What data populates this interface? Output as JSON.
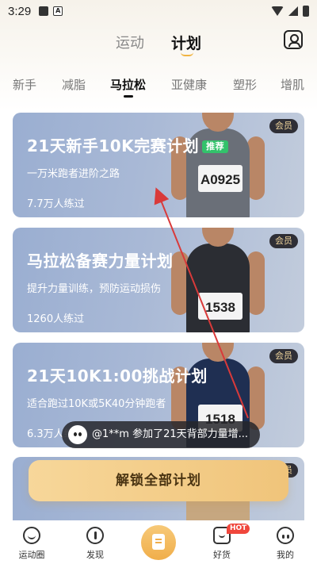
{
  "status_bar": {
    "time": "3:29"
  },
  "header": {
    "tabs": [
      {
        "label": "运动",
        "active": false
      },
      {
        "label": "计划",
        "active": true
      }
    ]
  },
  "categories": [
    {
      "label": "新手",
      "active": false
    },
    {
      "label": "减脂",
      "active": false
    },
    {
      "label": "马拉松",
      "active": true
    },
    {
      "label": "亚健康",
      "active": false
    },
    {
      "label": "塑形",
      "active": false
    },
    {
      "label": "增肌",
      "active": false
    }
  ],
  "cards": [
    {
      "title": "21天新手10K完赛计划",
      "badge": "推荐",
      "member": "会员",
      "subtitle": "一万米跑者进阶之路",
      "count": "7.7万人练过",
      "bib": "A0925"
    },
    {
      "title": "马拉松备赛力量计划",
      "member": "会员",
      "subtitle": "提升力量训练，预防运动损伤",
      "count": "1260人练过",
      "bib": "1538"
    },
    {
      "title": "21天10K1:00挑战计划",
      "member": "会员",
      "subtitle": "适合跑过10K或5K40分钟跑者",
      "count": "6.3万人练过",
      "bib": "1518"
    },
    {
      "title": "",
      "member": "会员",
      "subtitle": "",
      "count": "",
      "bib": ""
    }
  ],
  "toast": {
    "text": "@1**m 参加了21天背部力量增..."
  },
  "unlock_button": {
    "label": "解锁全部计划"
  },
  "bottom_nav": [
    {
      "label": "运动圈",
      "icon": "community-icon"
    },
    {
      "label": "发现",
      "icon": "compass-icon"
    },
    {
      "label": "",
      "icon": "plan-clipboard-icon"
    },
    {
      "label": "好货",
      "icon": "shopping-bag-icon",
      "badge": "HOT"
    },
    {
      "label": "我的",
      "icon": "profile-icon"
    }
  ],
  "colors": {
    "accent": "#f0b441",
    "card_bg": "#a9b9d6",
    "recommend_badge": "#33c26b",
    "hot_badge": "#f0463c",
    "arrow": "#d93a3a"
  }
}
